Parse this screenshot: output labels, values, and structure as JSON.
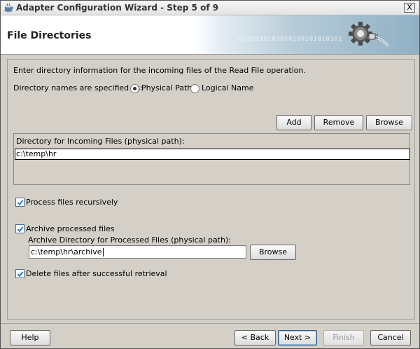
{
  "window": {
    "title": "Adapter Configuration Wizard - Step 5 of 9",
    "close_label": "X"
  },
  "header": {
    "title": "File Directories",
    "banner_binary": "0101010101010100101010101"
  },
  "intro": {
    "text": "Enter directory information for the incoming files of the Read File operation."
  },
  "naming": {
    "label": "Directory names are specified as:",
    "options": [
      {
        "label": "Physical Path",
        "selected": true
      },
      {
        "label": "Logical Name",
        "selected": false
      }
    ]
  },
  "dir_buttons": {
    "add": "Add",
    "remove": "Remove",
    "browse": "Browse"
  },
  "incoming": {
    "label": "Directory for Incoming Files (physical path):",
    "value": "c:\\temp\\hr"
  },
  "options": {
    "recursive": {
      "label": "Process files recursively",
      "checked": true
    },
    "archive": {
      "label": "Archive processed files",
      "checked": true
    },
    "delete": {
      "label": "Delete files after successful retrieval",
      "checked": true
    }
  },
  "archive_dir": {
    "label": "Archive Directory for Processed Files (physical path):",
    "value": "c:\\temp\\hr\\archive",
    "browse": "Browse"
  },
  "footer": {
    "help": "Help",
    "back": "< Back",
    "next": "Next >",
    "finish": "Finish",
    "cancel": "Cancel"
  },
  "colors": {
    "accent": "#2e5b8a",
    "check": "#1f6fc9",
    "background": "#d4d0c8"
  }
}
